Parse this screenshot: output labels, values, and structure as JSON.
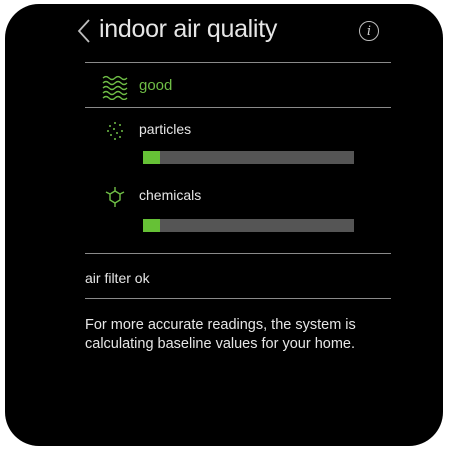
{
  "header": {
    "title": "indoor air quality",
    "info_label": "i"
  },
  "status": {
    "label": "good",
    "color": "#6fbe46"
  },
  "sensors": [
    {
      "label": "particles",
      "level": 0.08
    },
    {
      "label": "chemicals",
      "level": 0.08
    }
  ],
  "filter": {
    "label": "air filter ok"
  },
  "message": {
    "text": "For more accurate readings, the system is calculating baseline values for your home."
  },
  "colors": {
    "bar_fill": "#66c136",
    "bar_track": "#555555",
    "background": "#000000"
  },
  "icons": {
    "back": "chevron-left-icon",
    "info": "info-icon",
    "status": "air-waves-icon",
    "particles": "particles-icon",
    "chemicals": "chemicals-icon"
  }
}
